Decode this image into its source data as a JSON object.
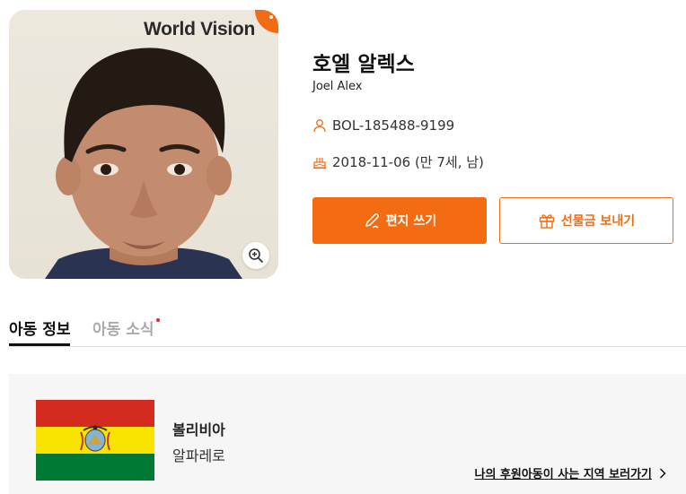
{
  "photo": {
    "brand": "World Vision"
  },
  "child": {
    "name_ko": "호엘 알렉스",
    "name_en": "Joel Alex",
    "child_id": "BOL-185488-9199",
    "birth": "2018-11-06 (만 7세, 남)"
  },
  "actions": {
    "letter_label": "편지 쓰기",
    "gift_label": "선물금 보내기"
  },
  "tabs": {
    "info": "아동 정보",
    "news": "아동 소식"
  },
  "country": {
    "name": "볼리비아",
    "region": "알파레로",
    "map_link": "나의 후원아동이 사는 지역 보러가기"
  },
  "colors": {
    "accent": "#f36b12",
    "flag_red": "#d52b1e",
    "flag_yellow": "#f9e300",
    "flag_green": "#007934"
  },
  "icons": [
    "zoom-in-icon",
    "user-icon",
    "birthday-cake-icon",
    "pen-icon",
    "gift-icon",
    "chevron-right-icon"
  ]
}
